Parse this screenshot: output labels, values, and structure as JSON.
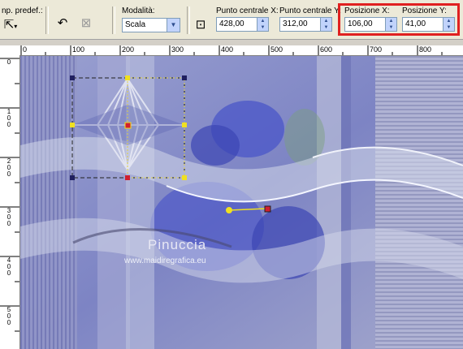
{
  "toolbar": {
    "preset_label": "np. predef.:",
    "mode_label": "Modalità:",
    "mode_value": "Scala",
    "center_x_label": "Punto centrale X:",
    "center_x_value": "428,00",
    "center_y_label": "Punto centrale Y:",
    "center_y_value": "312,00",
    "pos_x_label": "Posizione X:",
    "pos_x_value": "106,00",
    "pos_y_label": "Posizione Y:",
    "pos_y_value": "41,00",
    "highlight_color": "#e02020"
  },
  "ruler": {
    "top_labels": [
      "0",
      "100",
      "200",
      "300",
      "400",
      "500",
      "600",
      "700",
      "800"
    ],
    "left_labels": [
      "0",
      "1\n0\n0",
      "2\n0\n0",
      "3\n0\n0",
      "4\n0\n0",
      "5\n0\n0"
    ]
  },
  "canvas": {
    "watermark_name": "Pinuccia",
    "watermark_url": "www.maidiregrafica.eu",
    "colors": {
      "base": "#8a8fc8",
      "flower": "#4a55c8",
      "wave": "#c8cde0",
      "selection_line": "#202020",
      "handle_yellow": "#f0e020",
      "handle_red": "#d02030"
    }
  }
}
